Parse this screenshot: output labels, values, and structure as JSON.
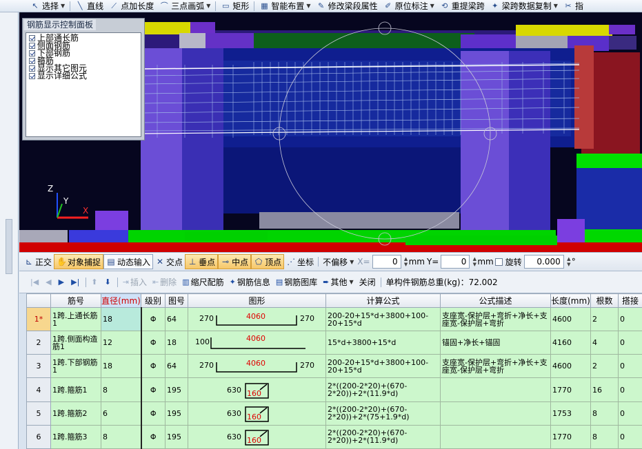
{
  "toolbar": {
    "items": [
      {
        "label": "选择",
        "icon": "cursor-icon",
        "dropdown": true
      },
      {
        "label": "直线",
        "icon": "line-icon",
        "dropdown": false
      },
      {
        "label": "点加长度",
        "icon": "point-length-icon",
        "dropdown": false
      },
      {
        "label": "三点画弧",
        "icon": "arc-icon",
        "dropdown": true
      },
      {
        "label": "矩形",
        "icon": "rectangle-icon",
        "dropdown": false
      },
      {
        "label": "智能布置",
        "icon": "smart-layout-icon",
        "dropdown": true
      },
      {
        "label": "修改梁段属性",
        "icon": "edit-beam-icon",
        "dropdown": false
      },
      {
        "label": "原位标注",
        "icon": "annotation-icon",
        "dropdown": true
      },
      {
        "label": "重提梁跨",
        "icon": "reextract-icon",
        "dropdown": false
      },
      {
        "label": "梁跨数据复制",
        "icon": "copy-span-icon",
        "dropdown": true
      },
      {
        "label": "指",
        "icon": "cut-icon",
        "dropdown": false
      }
    ]
  },
  "panel": {
    "title": "钢筋显示控制面板",
    "options": [
      {
        "label": "上部通长筋",
        "checked": true
      },
      {
        "label": "侧面钢筋",
        "checked": true
      },
      {
        "label": "下部钢筋",
        "checked": true
      },
      {
        "label": "箍筋",
        "checked": true
      },
      {
        "label": "显示其它图元",
        "checked": true
      },
      {
        "label": "显示详细公式",
        "checked": true
      }
    ]
  },
  "axes": {
    "x": "X",
    "y": "Y",
    "z": "Z"
  },
  "snap": {
    "ortho": "正交",
    "object_snap": "对象捕捉",
    "dynamic_input": "动态输入",
    "intersection": "交点",
    "perpendicular": "垂点",
    "midpoint": "中点",
    "vertex": "顶点",
    "coordinate": "坐标",
    "offset_mode": "不偏移",
    "x_label": "X=",
    "x_value": "0",
    "unit_mm": "mm",
    "y_label": "Y=",
    "y_value": "0",
    "unit_mm2": "mm",
    "rotate": "旋转",
    "rotate_value": "0.000",
    "degree": "°"
  },
  "gridbar": {
    "insert": "插入",
    "delete": "删除",
    "scale_rebar": "缩尺配筋",
    "rebar_info": "钢筋信息",
    "rebar_library": "钢筋图库",
    "other": "其他",
    "close": "关闭",
    "total_weight": "单构件钢筋总重(kg)：72.002"
  },
  "table": {
    "headers": [
      "",
      "筋号",
      "直径(mm)",
      "级别",
      "图号",
      "图形",
      "计算公式",
      "公式描述",
      "长度(mm)",
      "根数",
      "搭接"
    ],
    "rows": [
      {
        "num": "1*",
        "name": "1跨.上通长筋1",
        "dia": "18",
        "grade": "Φ",
        "fig": "64",
        "shape": {
          "left": "270",
          "mid": "4060",
          "right": "270"
        },
        "formula": "200-20+15*d+3800+100-20+15*d",
        "desc": "支座宽-保护层+弯折+净长+支座宽-保护层+弯折",
        "length": "4600",
        "count": "2",
        "lap": "0"
      },
      {
        "num": "2",
        "name": "1跨.侧面构造筋1",
        "dia": "12",
        "grade": "Φ",
        "fig": "18",
        "shape": {
          "left": "100",
          "mid": "4060",
          "right": ""
        },
        "formula": "15*d+3800+15*d",
        "desc": "锚固+净长+锚固",
        "length": "4160",
        "count": "4",
        "lap": "0"
      },
      {
        "num": "3",
        "name": "1跨.下部钢筋1",
        "dia": "18",
        "grade": "Φ",
        "fig": "64",
        "shape": {
          "left": "270",
          "mid": "4060",
          "right": "270"
        },
        "formula": "200-20+15*d+3800+100-20+15*d",
        "desc": "支座宽-保护层+弯折+净长+支座宽-保护层+弯折",
        "length": "4600",
        "count": "2",
        "lap": "0"
      },
      {
        "num": "4",
        "name": "1跨.箍筋1",
        "dia": "8",
        "grade": "Φ",
        "fig": "195",
        "shape": {
          "left": "630",
          "mid": "160",
          "right": ""
        },
        "formula": "2*((200-2*20)+(670-2*20))+2*(11.9*d)",
        "desc": "",
        "length": "1770",
        "count": "16",
        "lap": "0"
      },
      {
        "num": "5",
        "name": "1跨.箍筋2",
        "dia": "6",
        "grade": "Φ",
        "fig": "195",
        "shape": {
          "left": "630",
          "mid": "160",
          "right": ""
        },
        "formula": "2*((200-2*20)+(670-2*20))+2*(75+1.9*d)",
        "desc": "",
        "length": "1753",
        "count": "8",
        "lap": "0"
      },
      {
        "num": "6",
        "name": "1跨.箍筋3",
        "dia": "8",
        "grade": "Φ",
        "fig": "195",
        "shape": {
          "left": "630",
          "mid": "160",
          "right": ""
        },
        "formula": "2*((200-2*20)+(670-2*20))+2*(11.9*d)",
        "desc": "",
        "length": "1770",
        "count": "8",
        "lap": "0"
      }
    ]
  }
}
